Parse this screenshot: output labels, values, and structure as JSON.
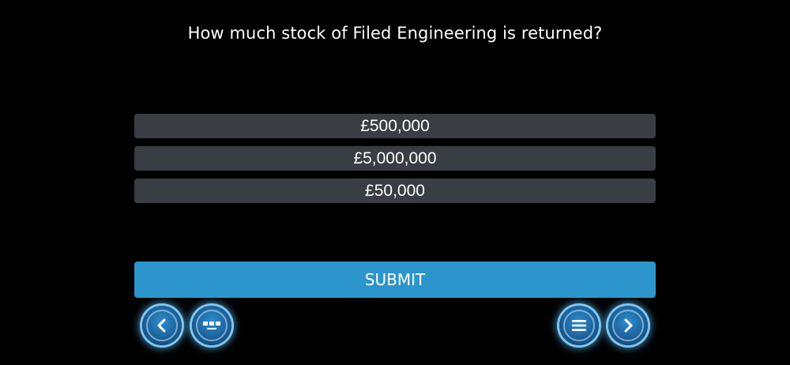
{
  "quiz": {
    "question": "How much stock of Filed Engineering is returned?",
    "options": [
      {
        "label": "£500,000"
      },
      {
        "label": "£5,000,000"
      },
      {
        "label": "£50,000"
      }
    ],
    "submit_label": "SUBMIT"
  },
  "navigation": {
    "back_icon": "chevron-left-icon",
    "gallery_icon": "slides-icon",
    "menu_icon": "menu-icon",
    "next_icon": "chevron-right-icon"
  },
  "colors": {
    "background": "#000000",
    "option_background": "#3a3d44",
    "submit_background": "#2b95cc",
    "nav_glow": "#7fc6ee",
    "text": "#ffffff"
  }
}
